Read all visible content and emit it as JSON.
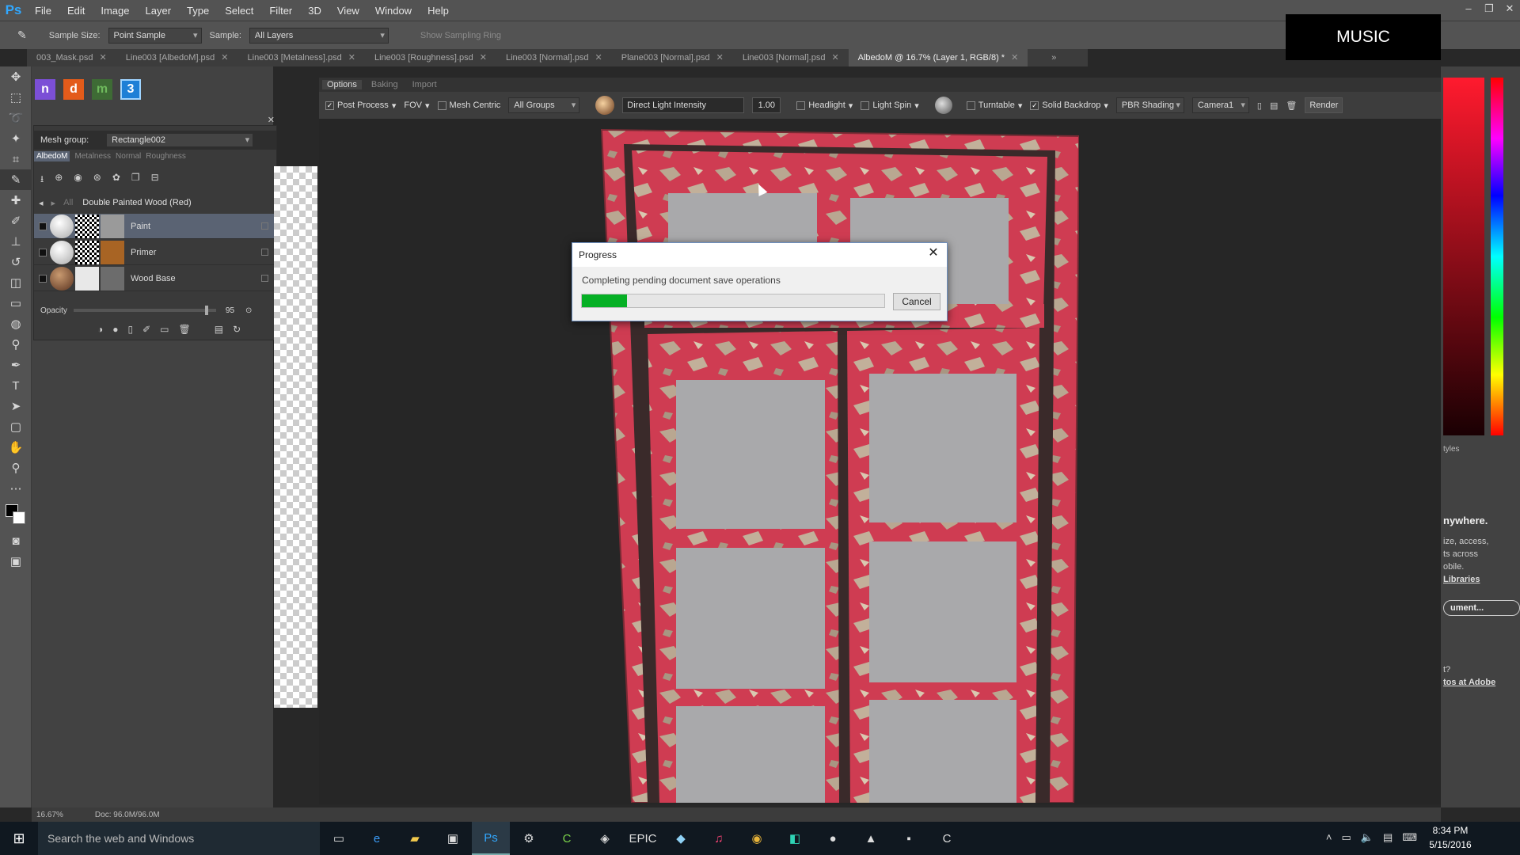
{
  "menubar": {
    "logo": "Ps",
    "items": [
      "File",
      "Edit",
      "Image",
      "Layer",
      "Type",
      "Select",
      "Filter",
      "3D",
      "View",
      "Window",
      "Help"
    ]
  },
  "optionsbar": {
    "sample_size_label": "Sample Size:",
    "sample_size_value": "Point Sample",
    "sample_label": "Sample:",
    "sample_value": "All Layers",
    "sampling_ring": "Show Sampling Ring"
  },
  "overlay": {
    "music_label": "MUSIC"
  },
  "tabs": [
    {
      "label": "003_Mask.psd"
    },
    {
      "label": "Line003 [AlbedoM].psd"
    },
    {
      "label": "Line003 [Metalness].psd"
    },
    {
      "label": "Line003 [Roughness].psd"
    },
    {
      "label": "Line003 [Normal].psd"
    },
    {
      "label": "Plane003 [Normal].psd"
    },
    {
      "label": "Line003 [Normal].psd"
    },
    {
      "label": "AlbedoM @ 16.7% (Layer 1, RGB/8) *"
    }
  ],
  "ddo": {
    "mesh_group_label": "Mesh group:",
    "mesh_group_value": "Rectangle002",
    "map_tabs": [
      "AlbedoM",
      "Metalness",
      "Normal",
      "Roughness"
    ],
    "breadcrumb_all": "All",
    "material_name": "Double Painted Wood (Red)",
    "layers": [
      {
        "name": "Paint"
      },
      {
        "name": "Primer"
      },
      {
        "name": "Wood Base"
      }
    ],
    "opacity_label": "Opacity",
    "opacity_value": "95"
  },
  "viewer": {
    "subtabs": [
      "Options",
      "Baking",
      "Import"
    ],
    "post_process": "Post Process",
    "fov": "FOV",
    "mesh_centric": "Mesh Centric",
    "groups_value": "All Groups",
    "light_label": "Direct Light Intensity",
    "light_value": "1.00",
    "headlight": "Headlight",
    "light_spin": "Light Spin",
    "turntable": "Turntable",
    "solid_backdrop": "Solid Backdrop",
    "shading_value": "PBR Shading",
    "camera_value": "Camera1",
    "render_label": "Render"
  },
  "right_panel": {
    "headline": "nywhere.",
    "lines": [
      "ize, access,",
      "ts across",
      "obile."
    ],
    "libraries_link": "Libraries",
    "doc_button": "ument...",
    "q": "t?",
    "adobe_link": "tos at Adobe",
    "styles_label": "tyles"
  },
  "status": {
    "zoom": "16.67%",
    "doc": "Doc: 96.0M/96.0M"
  },
  "dialog": {
    "title": "Progress",
    "message": "Completing pending document save operations",
    "progress": 0.15,
    "cancel_label": "Cancel"
  },
  "taskbar": {
    "search_placeholder": "Search the web and Windows",
    "time": "8:34 PM",
    "date": "5/15/2016"
  },
  "colors": {
    "progress_fill": "#06b025",
    "paint_red": "#d23a4e",
    "ps_blue": "#31a8ff"
  }
}
